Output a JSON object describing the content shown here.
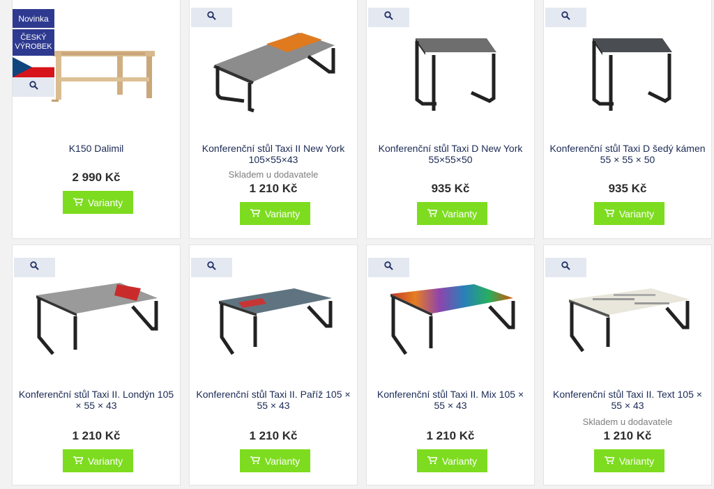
{
  "products": [
    {
      "title": "K150 Dalimil",
      "stock": "",
      "price": "2 990 Kč",
      "button": "Varianty"
    },
    {
      "title": "Konferenční stůl Taxi II New York 105×55×43",
      "stock": "Skladem u dodavatele",
      "price": "1 210 Kč",
      "button": "Varianty"
    },
    {
      "title": "Konferenční stůl Taxi D New York 55×55×50",
      "stock": "",
      "price": "935 Kč",
      "button": "Varianty"
    },
    {
      "title": "Konferenční stůl Taxi D šedý kámen 55 × 55 × 50",
      "stock": "",
      "price": "935 Kč",
      "button": "Varianty"
    },
    {
      "title": "Konferenční stůl Taxi II. Londýn 105 × 55 × 43",
      "stock": "",
      "price": "1 210 Kč",
      "button": "Varianty"
    },
    {
      "title": "Konferenční stůl Taxi II. Paříž 105 × 55 × 43",
      "stock": "",
      "price": "1 210 Kč",
      "button": "Varianty"
    },
    {
      "title": "Konferenční stůl Taxi II. Mix 105 × 55 × 43",
      "stock": "",
      "price": "1 210 Kč",
      "button": "Varianty"
    },
    {
      "title": "Konferenční stůl Taxi II. Text 105 × 55 × 43",
      "stock": "Skladem u dodavatele",
      "price": "1 210 Kč",
      "button": "Varianty"
    }
  ],
  "badges": {
    "novinka": "Novinka",
    "cesky_line1": "ČESKÝ",
    "cesky_line2": "VÝROBEK"
  },
  "icons": {
    "zoom": "magnifier-icon",
    "cart": "cart-icon",
    "flag": "czech-flag-icon"
  },
  "colors": {
    "button": "#7ddc1f",
    "badge": "#2e3a8f",
    "title": "#1b2a55",
    "zoom_bg": "#e4e8f1"
  }
}
